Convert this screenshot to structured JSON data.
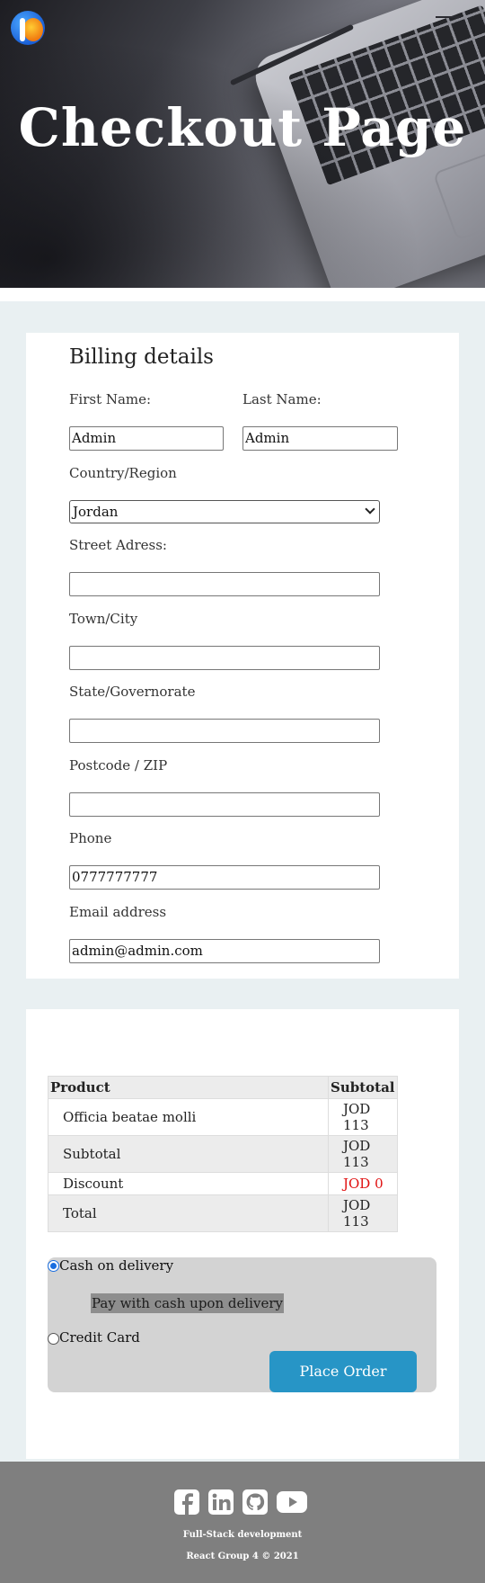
{
  "hero": {
    "title": "Checkout Page"
  },
  "billing": {
    "heading": "Billing details",
    "first_name": {
      "label": "First Name:",
      "value": "Admin"
    },
    "last_name": {
      "label": "Last Name:",
      "value": "Admin"
    },
    "country": {
      "label": "Country/Region",
      "value": "Jordan"
    },
    "street": {
      "label": "Street Adress:",
      "value": ""
    },
    "town": {
      "label": "Town/City",
      "value": ""
    },
    "state": {
      "label": "State/Governorate",
      "value": ""
    },
    "postcode": {
      "label": "Postcode / ZIP",
      "value": ""
    },
    "phone": {
      "label": "Phone",
      "value": "0777777777"
    },
    "email": {
      "label": "Email address",
      "value": "admin@admin.com"
    }
  },
  "order": {
    "headers": {
      "product": "Product",
      "subtotal": "Subtotal"
    },
    "rows": [
      {
        "label": "Officia beatae molli",
        "value": "JOD 113"
      },
      {
        "label": "Subtotal",
        "value": "JOD 113"
      },
      {
        "label": "Discount",
        "value": "JOD 0"
      },
      {
        "label": "Total",
        "value": "JOD 113"
      }
    ],
    "discount_color": "#e01010"
  },
  "payment": {
    "cod_label": "Cash on delivery",
    "cod_note": "Pay with cash upon delivery",
    "card_label": "Credit Card",
    "selected": "cod",
    "place_order": "Place Order",
    "button_color": "#2795c6"
  },
  "footer": {
    "line1": "Full-Stack development",
    "line2": "React Group 4 © 2021",
    "icons": [
      "facebook-icon",
      "linkedin-icon",
      "github-icon",
      "youtube-icon"
    ]
  }
}
